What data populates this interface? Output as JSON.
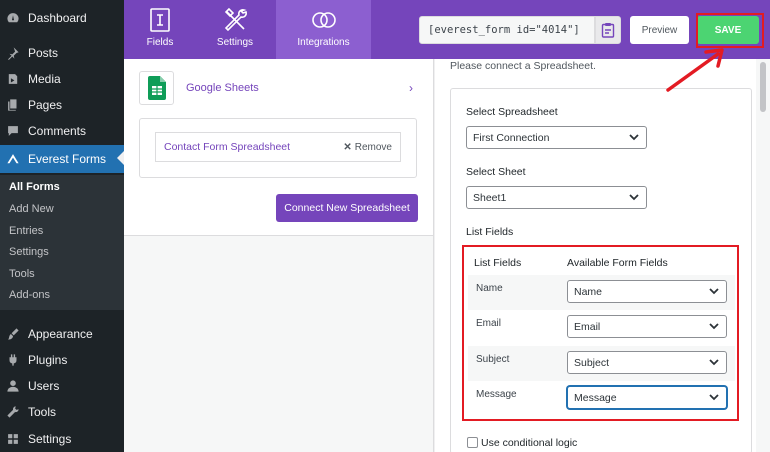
{
  "sidebar": {
    "items": [
      {
        "label": "Dashboard",
        "icon": "dashboard-icon"
      },
      {
        "label": "Posts",
        "icon": "pin-icon"
      },
      {
        "label": "Media",
        "icon": "media-icon"
      },
      {
        "label": "Pages",
        "icon": "pages-icon"
      },
      {
        "label": "Comments",
        "icon": "comment-icon"
      },
      {
        "label": "Everest Forms",
        "icon": "everest-forms-icon"
      },
      {
        "label": "Appearance",
        "icon": "brush-icon"
      },
      {
        "label": "Plugins",
        "icon": "plug-icon"
      },
      {
        "label": "Users",
        "icon": "user-icon"
      },
      {
        "label": "Tools",
        "icon": "wrench-icon"
      },
      {
        "label": "Settings",
        "icon": "settings-icon"
      }
    ],
    "submenu": [
      "All Forms",
      "Add New",
      "Entries",
      "Settings",
      "Tools",
      "Add-ons"
    ]
  },
  "topbar": {
    "tabs": [
      "Fields",
      "Settings",
      "Integrations"
    ],
    "shortcode": "[everest_form id=\"4014\"]",
    "preview_label": "Preview",
    "save_label": "SAVE"
  },
  "integration": {
    "title": "Google Sheets",
    "connection_name": "Contact Form Spreadsheet",
    "remove_label": "Remove",
    "connect_new_label": "Connect New Spreadsheet"
  },
  "settings": {
    "connect_message": "Please connect a Spreadsheet.",
    "select_spreadsheet_label": "Select Spreadsheet",
    "spreadsheet_value": "First Connection",
    "select_sheet_label": "Select Sheet",
    "sheet_value": "Sheet1",
    "list_fields_label": "List Fields",
    "table_headers": [
      "List Fields",
      "Available Form Fields"
    ],
    "rows": [
      {
        "field": "Name",
        "value": "Name"
      },
      {
        "field": "Email",
        "value": "Email"
      },
      {
        "field": "Subject",
        "value": "Subject"
      },
      {
        "field": "Message",
        "value": "Message"
      }
    ],
    "conditional_logic_label": "Use conditional logic"
  },
  "colors": {
    "brand_purple": "#7545bb",
    "save_green": "#4cd472",
    "annotation_red": "#e31b23",
    "wp_blue": "#2271b1"
  }
}
